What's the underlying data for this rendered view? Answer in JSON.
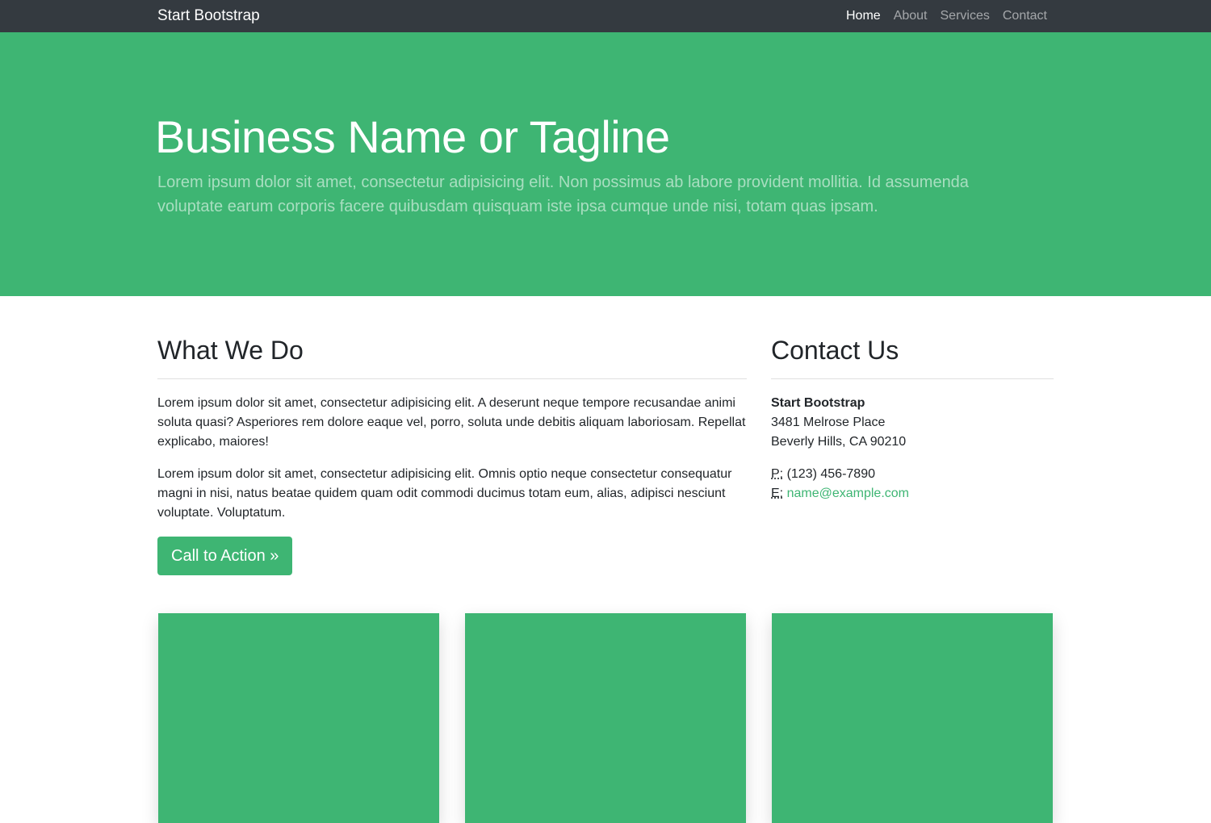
{
  "navbar": {
    "brand": "Start Bootstrap",
    "links": [
      {
        "label": "Home",
        "active": true
      },
      {
        "label": "About",
        "active": false
      },
      {
        "label": "Services",
        "active": false
      },
      {
        "label": "Contact",
        "active": false
      }
    ]
  },
  "hero": {
    "title": "Business Name or Tagline",
    "lead": "Lorem ipsum dolor sit amet, consectetur adipisicing elit. Non possimus ab labore provident mollitia. Id assumenda voluptate earum corporis facere quibusdam quisquam iste ipsa cumque unde nisi, totam quas ipsam."
  },
  "what_we_do": {
    "heading": "What We Do",
    "paragraphs": [
      "Lorem ipsum dolor sit amet, consectetur adipisicing elit. A deserunt neque tempore recusandae animi soluta quasi? Asperiores rem dolore eaque vel, porro, soluta unde debitis aliquam laboriosam. Repellat explicabo, maiores!",
      "Lorem ipsum dolor sit amet, consectetur adipisicing elit. Omnis optio neque consectetur consequatur magni in nisi, natus beatae quidem quam odit commodi ducimus totam eum, alias, adipisci nesciunt voluptate. Voluptatum."
    ],
    "cta_label": "Call to Action »"
  },
  "contact": {
    "heading": "Contact Us",
    "company": "Start Bootstrap",
    "street": "3481 Melrose Place",
    "city": "Beverly Hills, CA 90210",
    "phone_label": "P:",
    "phone": "(123) 456-7890",
    "email_label": "E:",
    "email": "name@example.com"
  },
  "colors": {
    "accent": "#3eb573",
    "navbar_bg": "#343a40"
  }
}
